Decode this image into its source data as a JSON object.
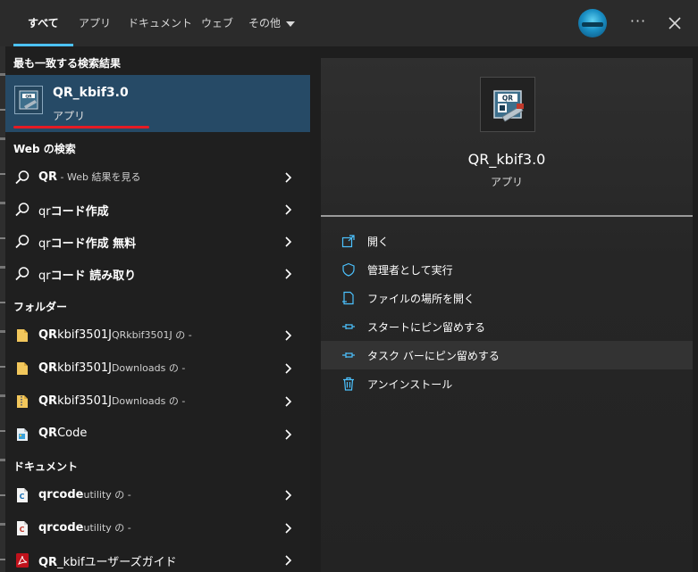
{
  "tabs": [
    {
      "label": "すべて",
      "active": true
    },
    {
      "label": "アプリ"
    },
    {
      "label": "ドキュメント"
    },
    {
      "label": "ウェブ"
    },
    {
      "label": "その他"
    }
  ],
  "topbar": {
    "more_label": "···"
  },
  "best_match": {
    "header": "最も一致する検索結果",
    "title": "QR_kbif3.0",
    "subtitle": "アプリ",
    "icon": "qr-app-icon"
  },
  "web": {
    "header": "Web の検索",
    "items": [
      {
        "bold": "QR",
        "rest": " - Web 結果を見る",
        "icon": "search-icon"
      },
      {
        "bold": "",
        "pre": "qr",
        "boldAfter": "コード作成",
        "icon": "search-icon"
      },
      {
        "pre": "qr",
        "boldAfter": "コード作成 無料",
        "icon": "search-icon"
      },
      {
        "pre": "qr",
        "boldAfter": "コード 読み取り",
        "icon": "search-icon"
      }
    ]
  },
  "folders": {
    "header": "フォルダー",
    "items": [
      {
        "bold": "QR",
        "main": "kbif3501J",
        "small": "QRkbif3501J の -",
        "icon": "folder-icon"
      },
      {
        "bold": "QR",
        "main": "kbif3501J",
        "small": "Downloads の -",
        "icon": "folder-icon"
      },
      {
        "bold": "QR",
        "main": "kbif3501J",
        "small": "Downloads の -",
        "icon": "zip-folder-icon"
      },
      {
        "bold": "QR",
        "main": "Code",
        "small": "",
        "icon": "drive-folder-icon"
      }
    ]
  },
  "documents": {
    "header": "ドキュメント",
    "items": [
      {
        "bold": "qrcode",
        "small": "utility の -",
        "icon": "document-icon"
      },
      {
        "bold": "qrcode",
        "small": "utility の -",
        "icon": "document-icon"
      },
      {
        "bold": "QR",
        "main": "_kbifユーザーズガイド",
        "small": "",
        "icon": "pdf-icon"
      }
    ]
  },
  "preview": {
    "title": "QR_kbif3.0",
    "subtitle": "アプリ",
    "actions": [
      {
        "label": "開く",
        "icon": "open-icon"
      },
      {
        "label": "管理者として実行",
        "icon": "shield-icon"
      },
      {
        "label": "ファイルの場所を開く",
        "icon": "file-location-icon"
      },
      {
        "label": "スタートにピン留めする",
        "icon": "pin-icon"
      },
      {
        "label": "タスク バーにピン留めする",
        "icon": "pin-icon",
        "hover": true
      },
      {
        "label": "アンインストール",
        "icon": "trash-icon"
      }
    ]
  },
  "colors": {
    "accent": "#4cc2ff",
    "selected": "#264a66",
    "underline": "#e51b24"
  }
}
